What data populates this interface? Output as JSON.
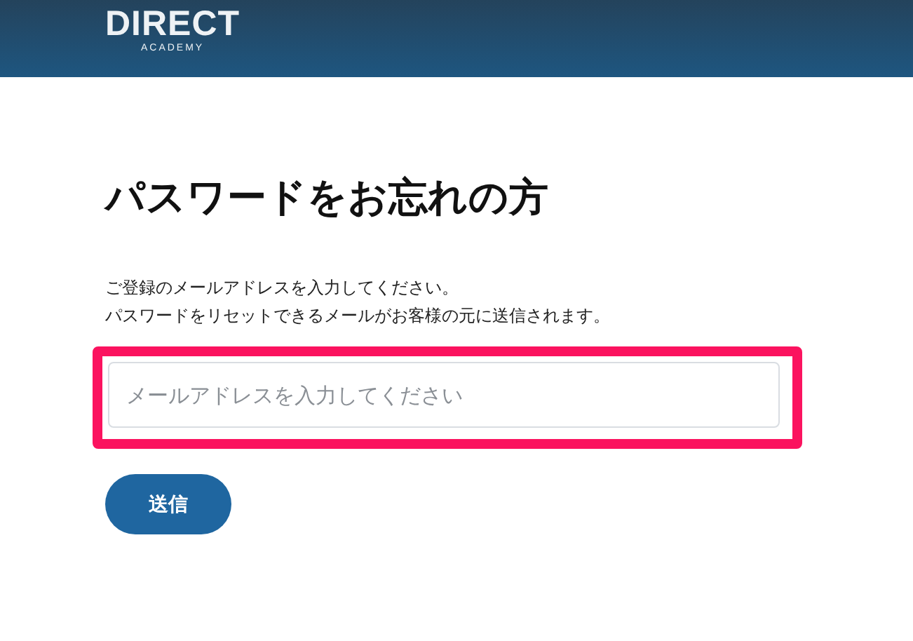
{
  "header": {
    "logo": {
      "name": "DIRECT",
      "subtitle": "ACADEMY"
    }
  },
  "title": "パスワードをお忘れの方",
  "description": [
    "ご登録のメールアドレスを入力してください。",
    "パスワードをリセットできるメールがお客様の元に送信されます。"
  ],
  "email_field": {
    "placeholder": "メールアドレスを入力してください",
    "highlighted": true
  },
  "submit_button": "送信"
}
